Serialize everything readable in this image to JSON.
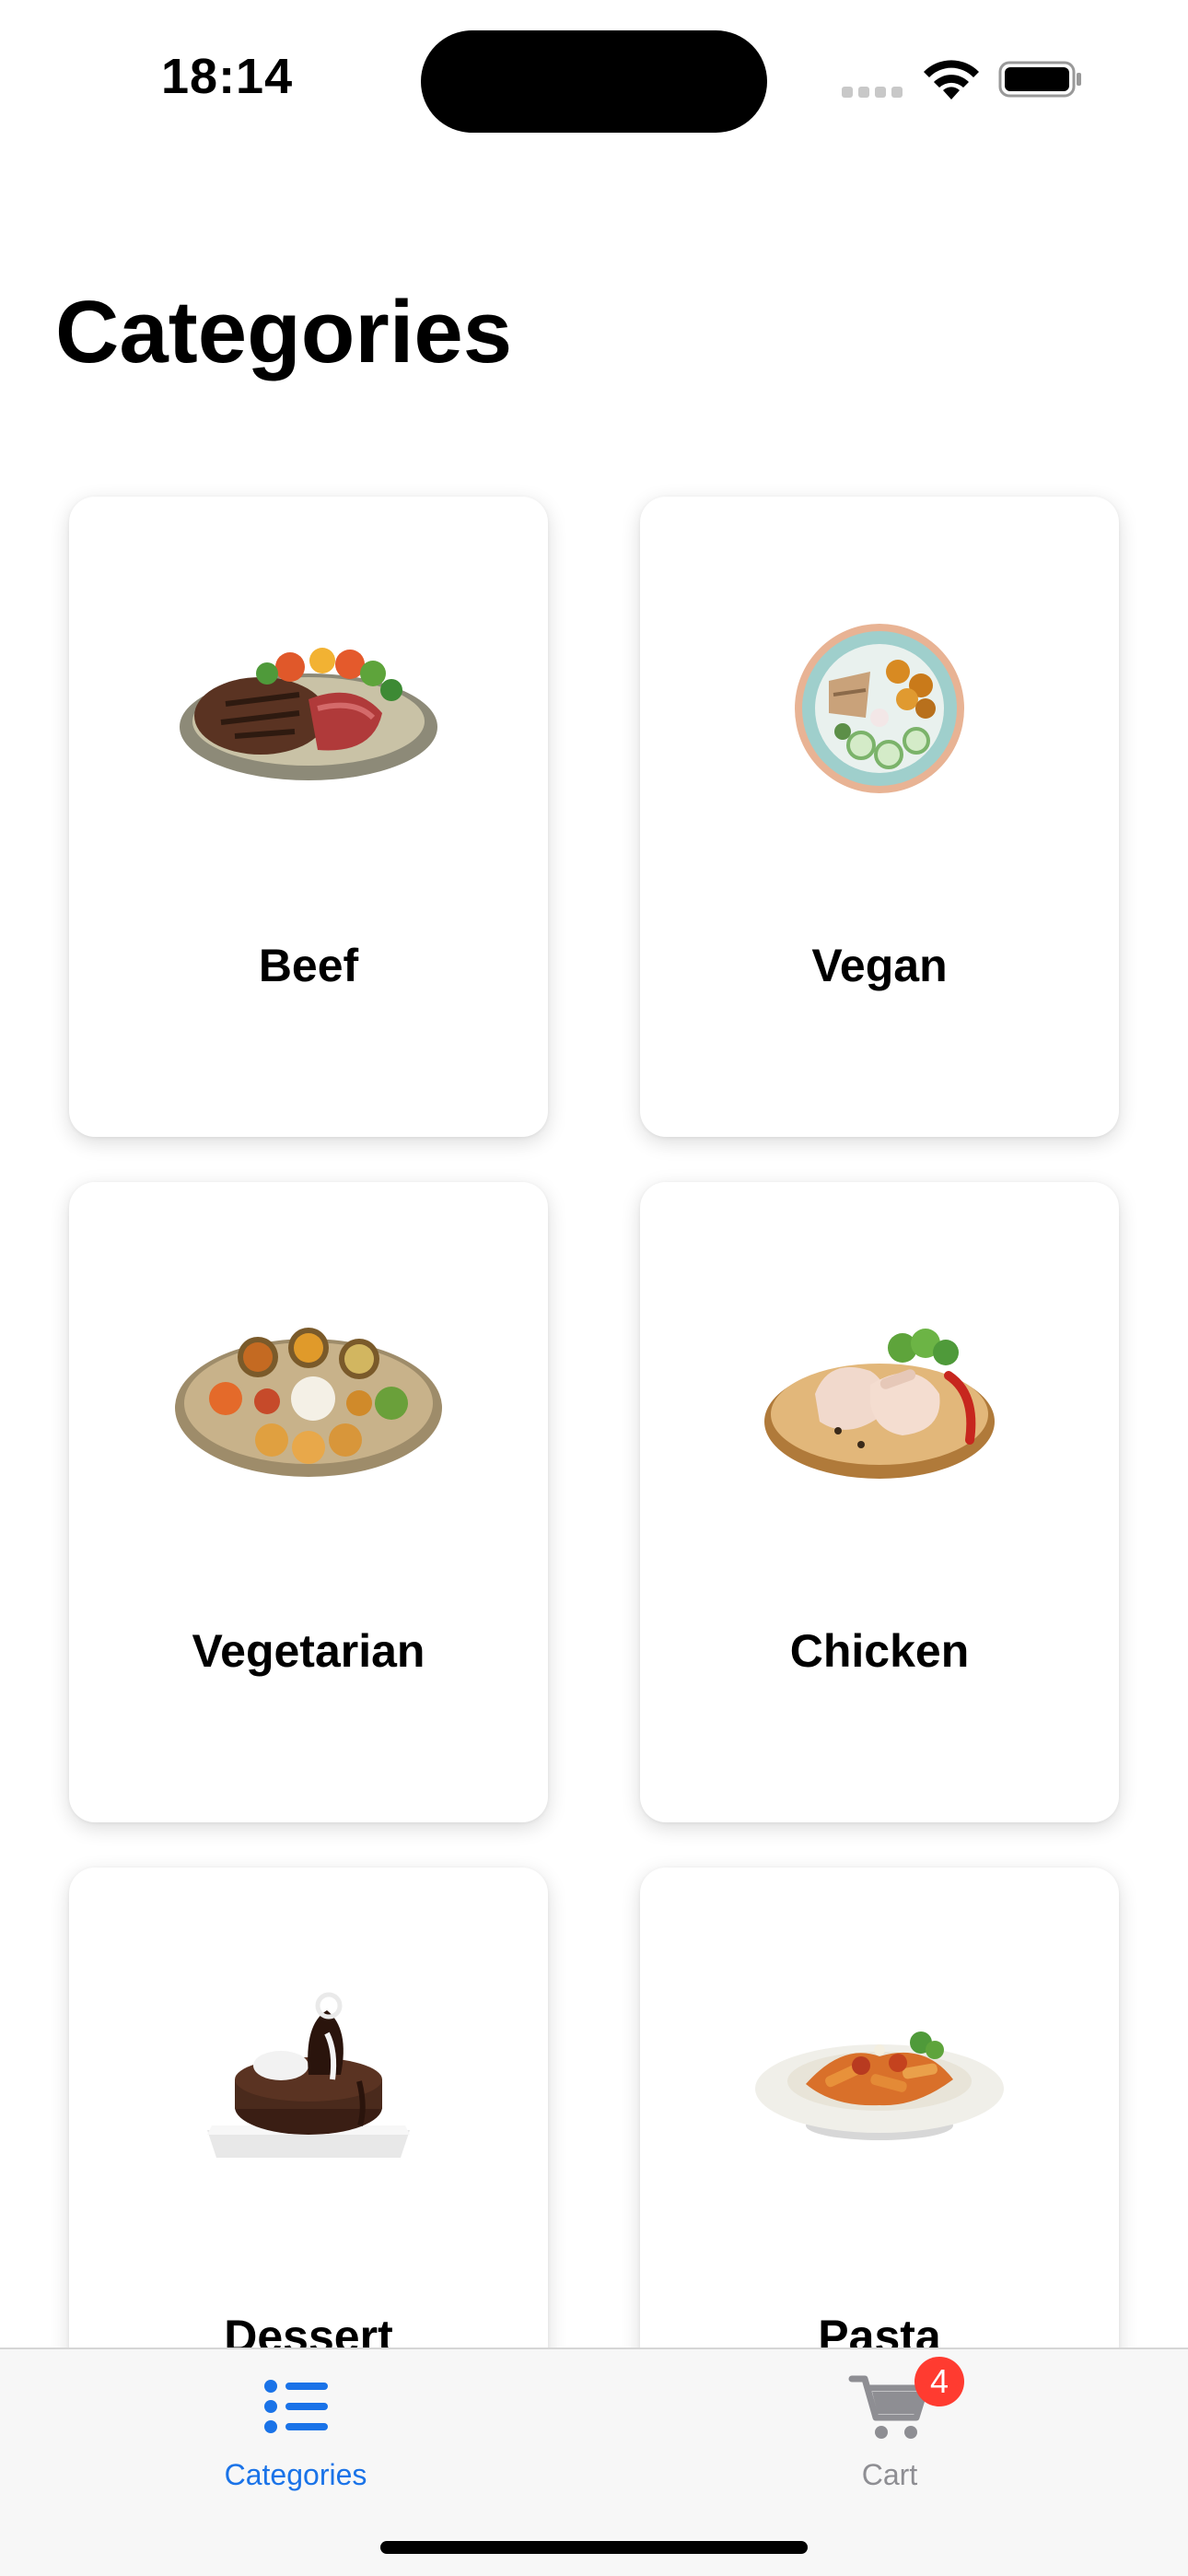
{
  "status_bar": {
    "time": "18:14"
  },
  "page": {
    "title": "Categories"
  },
  "categories": [
    {
      "label": "Beef",
      "icon": "beef-steak-icon"
    },
    {
      "label": "Vegan",
      "icon": "vegan-bowl-icon"
    },
    {
      "label": "Vegetarian",
      "icon": "vegetarian-thali-icon"
    },
    {
      "label": "Chicken",
      "icon": "chicken-legs-icon"
    },
    {
      "label": "Dessert",
      "icon": "dessert-cake-icon"
    },
    {
      "label": "Pasta",
      "icon": "pasta-plate-icon"
    }
  ],
  "tab_bar": {
    "categories_label": "Categories",
    "cart_label": "Cart",
    "cart_badge": "4",
    "active_tab": "Categories"
  },
  "colors": {
    "accent": "#1a73e8",
    "inactive": "#8e8e93",
    "badge": "#ff3b30"
  }
}
